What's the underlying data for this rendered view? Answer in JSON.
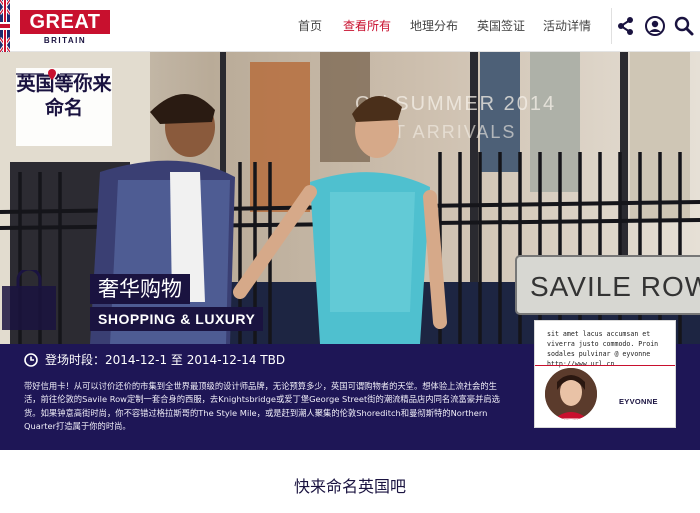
{
  "header": {
    "logo_main": "GREAT",
    "logo_sub": "BRITAIN",
    "nav": [
      {
        "label": "首页",
        "active": false
      },
      {
        "label": "查看所有",
        "active": true
      },
      {
        "label": "地理分布",
        "active": false
      },
      {
        "label": "英国签证",
        "active": false
      },
      {
        "label": "活动详情",
        "active": false
      }
    ],
    "icons": [
      "share-icon",
      "user-icon",
      "search-icon"
    ]
  },
  "hero": {
    "badge_title": "英国等你来命名",
    "category_zh": "奢华购物",
    "category_en": "SHOPPING & LUXURY",
    "street_sign": "SAVILE ROW",
    "window_text_line1": "G / SUMMER 2014",
    "window_text_line2": "ST ARRIVALS"
  },
  "event": {
    "period": "登场时段：2014-12-1 至 2014-12-14 TBD",
    "description": "带好信用卡！从可以讨价还价的市集到全世界最顶级的设计师品牌，无论预算多少，英国可谓购物者的天堂。想体验上流社会的生活，前往伦敦的Savile Row定制一套合身的西服，去Knightsbridge或爱丁堡George Street街的潮流精品店内同名流富豪并肩选货。如果钟意高街时尚，你不容错过格拉斯哥的The Style Mile，或是赶到潮人聚集的伦敦Shoreditch和曼彻斯特的Northern Quarter打造属于你的时尚。"
  },
  "tweet": {
    "text": "sit amet lacus accumsan et viverra justo commodo. Proin sodales pulvinar @ eyvonne http://www.url.cn",
    "user": "EYVONNE"
  },
  "footer": {
    "section_title": "快来命名英国吧"
  },
  "colors": {
    "brand_red": "#c8102e",
    "navy": "#1a1340",
    "band": "#1e1656"
  }
}
